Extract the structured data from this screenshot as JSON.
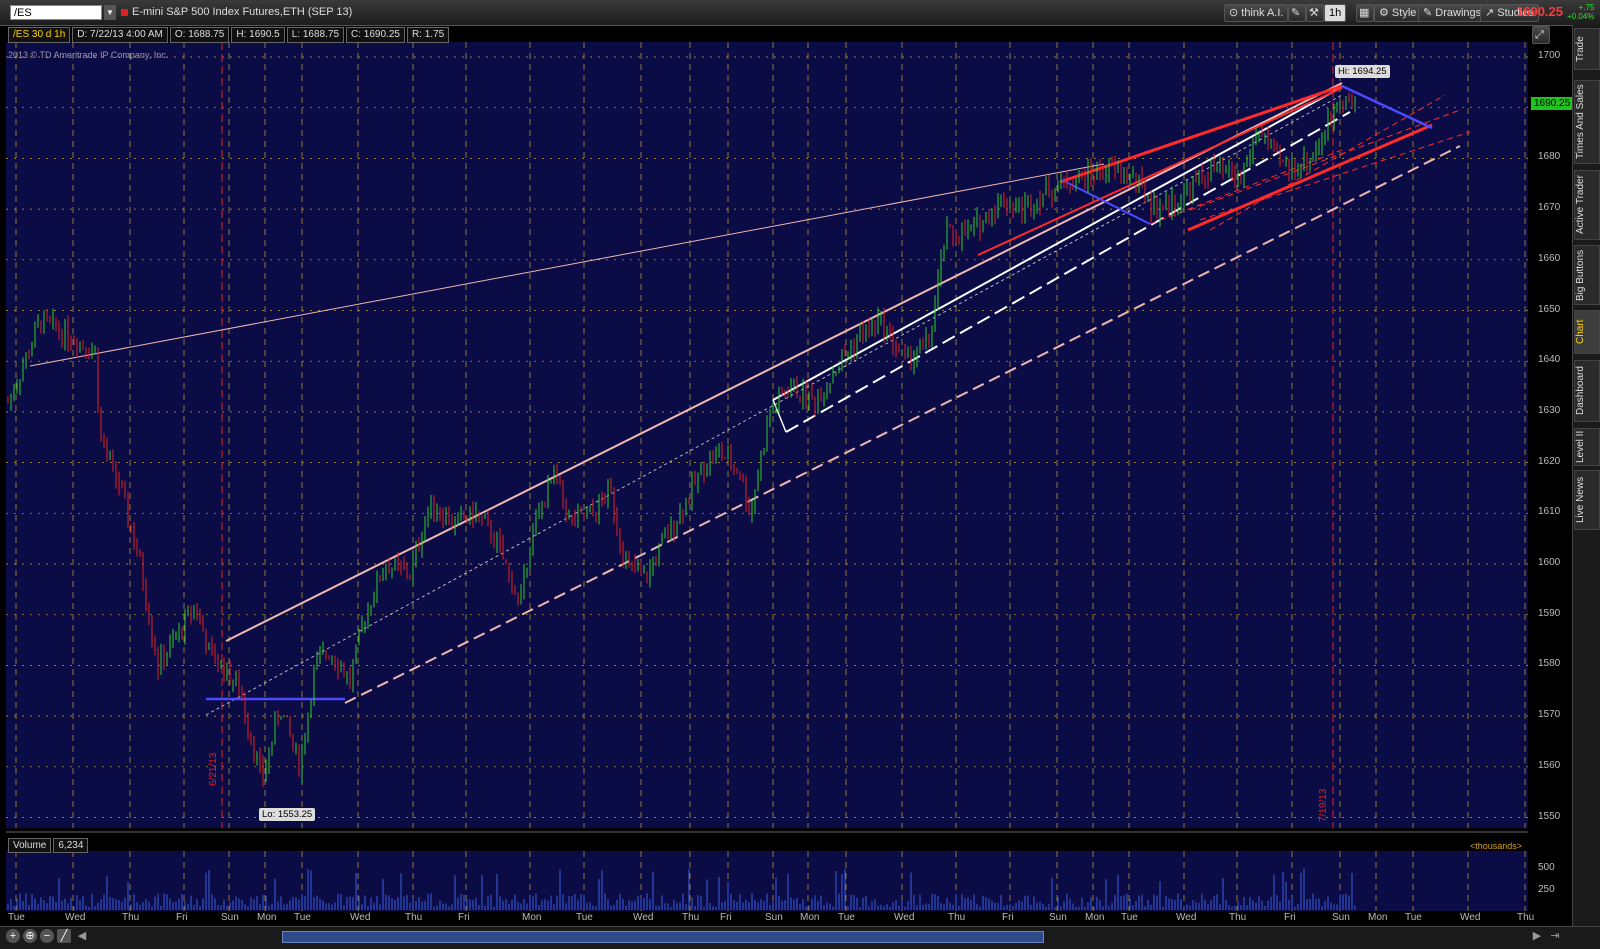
{
  "toolbar": {
    "symbol": "/ES",
    "description": "E-mini S&P 500 Index Futures,ETH (SEP 13)",
    "think_ai": "think A.I.",
    "interval": "1h",
    "style": "Style",
    "drawings": "Drawings",
    "studies": "Studies",
    "last_price": "1690.25",
    "change": "+.75",
    "change_pct": "+0.04%"
  },
  "header": {
    "symbol_info": "/ES 30 d 1h",
    "date": "D: 7/22/13 4:00 AM",
    "open": "O: 1688.75",
    "high": "H: 1690.5",
    "low": "L: 1688.75",
    "close": "C: 1690.25",
    "range": "R: 1.75"
  },
  "copyright": "2013 © TD Ameritrade IP Company, Inc.",
  "price_axis": [
    "1700",
    "1690",
    "1680",
    "1670",
    "1660",
    "1650",
    "1640",
    "1630",
    "1620",
    "1610",
    "1600",
    "1590",
    "1580",
    "1570",
    "1560",
    "1550"
  ],
  "current_price_tag": "1690.25",
  "high_label": "Hi: 1694.25",
  "low_label": "Lo: 1553.25",
  "marker_dates": [
    "6/21/13",
    "7/19/13"
  ],
  "volume": {
    "label": "Volume",
    "value": "6,234",
    "units": "<thousands>",
    "axis": [
      "500",
      "250"
    ]
  },
  "x_axis": [
    "Tue",
    "Wed",
    "Thu",
    "Fri",
    "Sun",
    "Mon",
    "Tue",
    "Wed",
    "Thu",
    "Fri",
    "Mon",
    "Tue",
    "Wed",
    "Thu",
    "Fri",
    "Sun",
    "Mon",
    "Tue",
    "Wed",
    "Thu",
    "Fri",
    "Sun",
    "Mon",
    "Tue",
    "Wed",
    "Thu",
    "Fri",
    "Sun",
    "Mon",
    "Tue",
    "Wed",
    "Thu"
  ],
  "sidebar_tabs": [
    "Trade",
    "Times And Sales",
    "Active Trader",
    "Big Buttons",
    "Chart",
    "Dashboard",
    "Level II",
    "Live News"
  ],
  "colors": {
    "chart_bg": "#0b0b45",
    "grid": "#c8a832",
    "up": "#2ecc2e",
    "down": "#e02020",
    "trend_pink": "#f0b8b0",
    "trend_red": "#ff2a2a",
    "trend_blue": "#4a4aff"
  }
}
